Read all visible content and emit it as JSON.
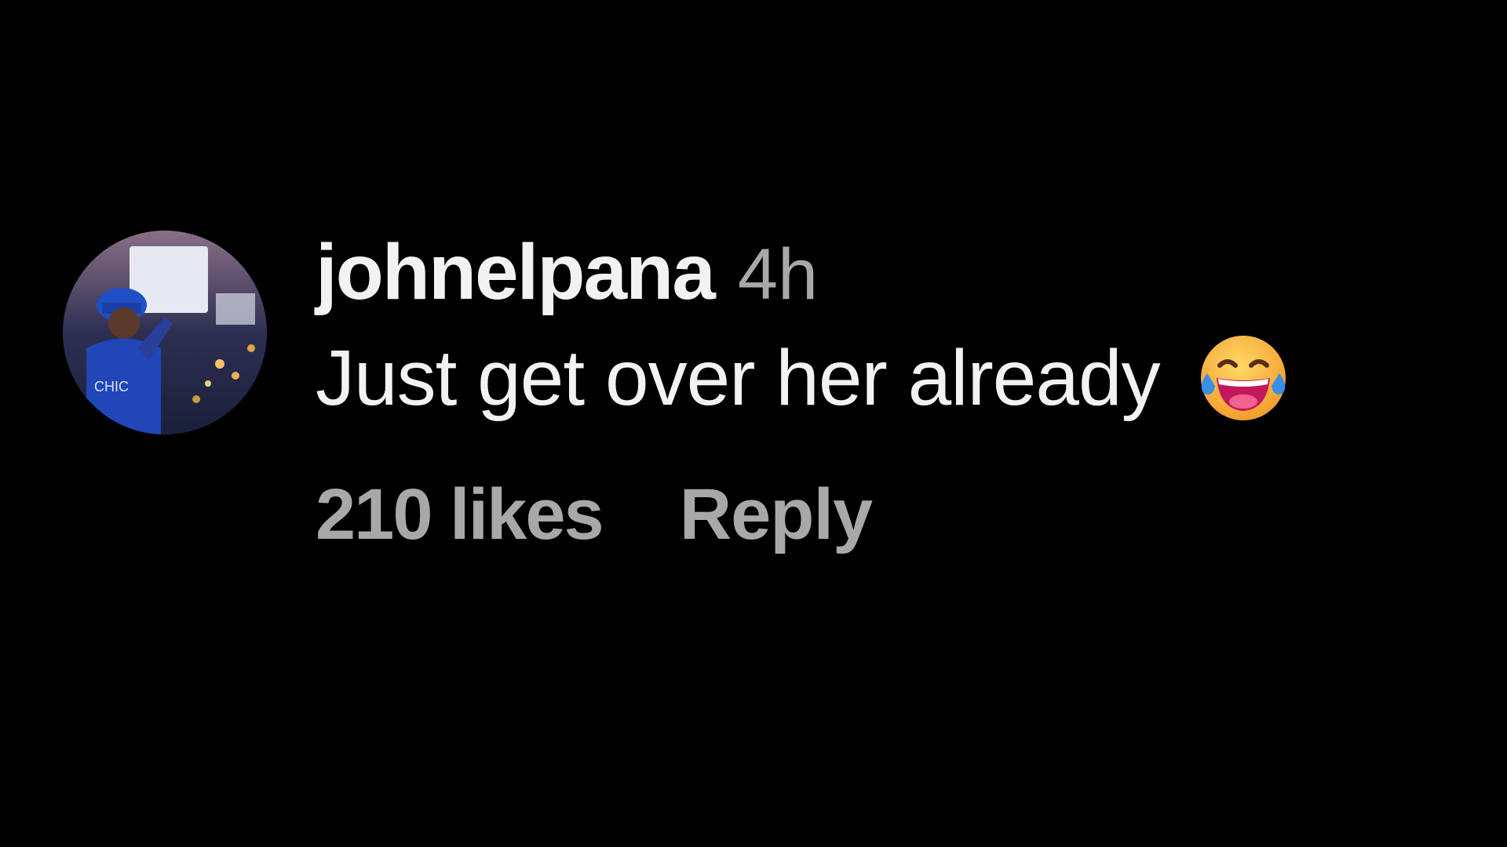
{
  "comment": {
    "username": "johnelpana",
    "time": "4h",
    "text": "Just get over her already",
    "emoji": "face-with-tears-of-joy-icon",
    "likes": "210 likes",
    "reply_label": "Reply"
  },
  "colors": {
    "background": "#000000",
    "primary_text": "#f2f2f2",
    "secondary_text": "#a8a8a8",
    "emoji_face": "#f7b733",
    "emoji_mouth": "#e0338a",
    "emoji_tears": "#3a8ee6"
  }
}
